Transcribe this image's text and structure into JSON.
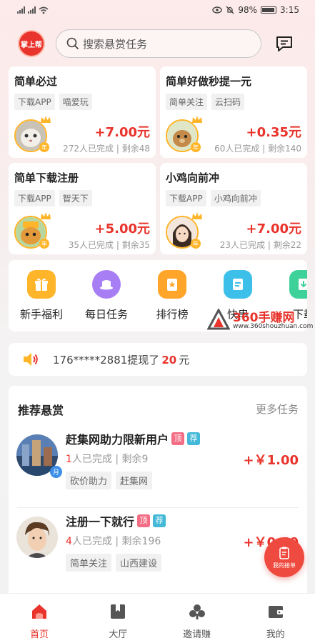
{
  "status_bar": {
    "battery": "98%",
    "time": "3:15"
  },
  "header": {
    "logo_text": "掌上帮",
    "search_placeholder": "搜索悬赏任务"
  },
  "task_cards": [
    {
      "title": "简单必过",
      "tags": [
        "下载APP",
        "喵爱玩"
      ],
      "price": "+7.00元",
      "meta": "272人已完成 | 剩余48",
      "badge": "年"
    },
    {
      "title": "简单好做秒提一元",
      "tags": [
        "简单关注",
        "云扫码"
      ],
      "price": "+0.35元",
      "meta": "60人已完成 | 剩余140",
      "badge": "年"
    },
    {
      "title": "简单下载注册",
      "tags": [
        "下载APP",
        "智天下"
      ],
      "price": "+5.00元",
      "meta": "35人已完成 | 剩余35",
      "badge": "年"
    },
    {
      "title": "小鸡向前冲",
      "tags": [
        "下载APP",
        "小鸡向前冲"
      ],
      "price": "+7.00元",
      "meta": "23人已完成 | 剩余22",
      "badge": "年"
    }
  ],
  "quick_menu": [
    {
      "label": "新手福利",
      "icon": "gift-icon",
      "color": "#ffb52a"
    },
    {
      "label": "每日任务",
      "icon": "hat-icon",
      "color": "#a87ef5"
    },
    {
      "label": "排行榜",
      "icon": "ranking-icon",
      "color": "#ffa52a"
    },
    {
      "label": "快串",
      "icon": "card-icon",
      "color": "#3cc0ea"
    },
    {
      "label": "下载",
      "icon": "download-icon",
      "color": "#3fd19a"
    }
  ],
  "watermark": {
    "name": "360手赚网",
    "url": "www.360shouzhuan.com"
  },
  "notice": {
    "prefix": "176*****2881提现了",
    "amount": "20",
    "suffix": "元"
  },
  "recommended": {
    "title": "推荐悬赏",
    "more": "更多任务",
    "items": [
      {
        "name": "赶集网助力限新用户",
        "flag_top": "顶",
        "flag_rec": "荐",
        "done_count": "1",
        "done_text": "人已完成",
        "remain": "剩余9",
        "tags": [
          "砍价助力",
          "赶集网"
        ],
        "price": "+￥1.00",
        "badge": "月"
      },
      {
        "name": "注册一下就行",
        "flag_top": "顶",
        "flag_rec": "荐",
        "done_count": "4",
        "done_text": "人已完成",
        "remain": "剩余196",
        "tags": [
          "简单关注",
          "山西建设"
        ],
        "price": "+￥0.40"
      }
    ]
  },
  "fab": {
    "label": "我的接单"
  },
  "tabbar": [
    {
      "label": "首页",
      "icon": "home-icon",
      "active": true
    },
    {
      "label": "大厅",
      "icon": "hall-icon"
    },
    {
      "label": "邀请赚",
      "icon": "invite-icon"
    },
    {
      "label": "我的",
      "icon": "wallet-icon"
    }
  ],
  "colors": {
    "accent": "#e8342c",
    "gold": "#ffb52a"
  }
}
